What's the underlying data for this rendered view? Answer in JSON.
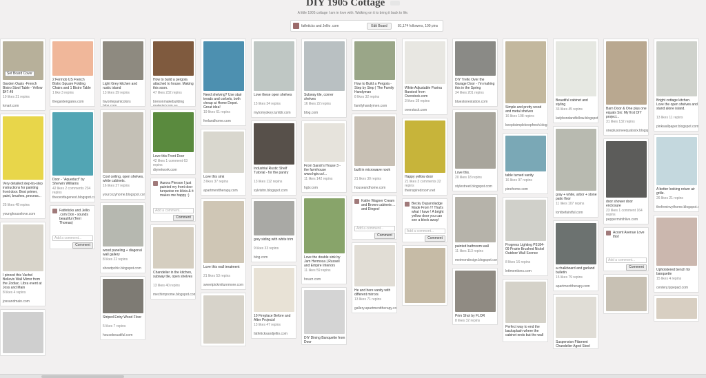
{
  "board": {
    "title": "DIY 1905 Cottage",
    "edit_badge": "Edit",
    "description": "A little 1905 cottage I am in love with. Walking on it to bring it back to life.",
    "owners": "fatfeticks and Jellio .com",
    "edit_button": "Edit Board",
    "stats": "81,174 followers, 100 pins"
  },
  "comment": {
    "placeholder": "Add a comment...",
    "button": "Comment"
  },
  "colors": {
    "bg": "#f2f0f0",
    "pin_bg": "#ffffff",
    "border": "#dddddd"
  },
  "columns": [
    {
      "pins": [
        {
          "desc": "Garden Oasis -French Bistro Stool Table - Yellow $47.49",
          "stats": "10 likes 21 repins",
          "src": "kmart.com",
          "color": "#b7b09a",
          "h": 56,
          "overlay": "Set Board Cover"
        },
        {
          "desc": "Very detailed step-by-step instructions for painting front door. Best primer, paint, brushes, process...",
          "stats": "25 likes 48 repins",
          "src": "younghouselove.com",
          "color": "#e8d64a",
          "h": 92
        },
        {
          "desc": "I pinned this Vachel Bellevis Wall Mirror from the Zodiac. Libra event at Joss and Main",
          "stats": "8 likes 4 repins",
          "src": "jossandmain.com",
          "color": "#d8d4ca",
          "h": 68
        },
        {
          "desc": "",
          "stats": "",
          "src": "",
          "color": "#cfcfcf",
          "h": 60
        }
      ]
    },
    {
      "pins": [
        {
          "desc": "2 Fermob US French Bistro Square Folding Chairs and 1 Bistro Table",
          "stats": "1 like 3 repins",
          "src": "thegardengates.com",
          "color": "#f0b79a",
          "h": 50
        },
        {
          "desc": "Door - \"Aqueduct\" by Sherwin Williams",
          "stats": "42 likes 2 comments 234 repins",
          "src": "theceottagenest.blogspot.com",
          "color": "#52a5b4",
          "h": 92
        },
        {
          "desc": "Fatfeticks and Jellio .com Don - sounds beautiful (Terri Thomas)",
          "stats": "",
          "src": "",
          "color": "#ffffff",
          "h": 0,
          "comment_area": true
        }
      ]
    },
    {
      "pins": [
        {
          "desc": "Light Grey kitchen and rustic island",
          "stats": "13 likes 39 repins",
          "src": "favoritepaintcolors blog.com",
          "color": "#8e8a80",
          "h": 56
        },
        {
          "desc": "Cool ceiling, open shelves, white cabinets.",
          "stats": "16 likes 27 repins",
          "src": "yourcozyhome.blogspot.com",
          "color": "#c4c0b6",
          "h": 88
        },
        {
          "desc": "wood paneling + diagonal wall gallery",
          "stats": "8 likes 22 repins",
          "src": "showtpchic.blogspot.com",
          "color": "#b6b8b0",
          "h": 60
        },
        {
          "desc": "Striped Entry Wood Floor",
          "stats": "5 likes 7 repins",
          "src": "housebeautiful.com",
          "color": "#7e7b74",
          "h": 50
        }
      ]
    },
    {
      "pins": [
        {
          "desc": "How to build a pergola attached to house. Making this soon.",
          "stats": "47 likes 232 repins",
          "src": "brenonmakebuilding material.com.au",
          "color": "#7f5a3e",
          "h": 50
        },
        {
          "desc": "Love this Front Door",
          "stats": "42 likes 1 comment 63 repins",
          "src": "diynetwork.com",
          "color": "#5a8a3e",
          "h": 58
        },
        {
          "desc": "Aurora Pierson I just painted my front door turquoise no kilvia & it makes me happy :)",
          "stats": "",
          "src": "",
          "color": "#ffffff",
          "h": 0,
          "comment_area": true
        },
        {
          "desc": "Chandelier in the kitchen, subway tile, open shelves",
          "stats": "13 likes 40 repins",
          "src": "mechimprome.blogspot.com",
          "color": "#d5cec0",
          "h": 60
        }
      ]
    },
    {
      "pins": [
        {
          "desc": "Need shelving? Use stair treads and corbels, both cheap at Home Depot. Great idea!",
          "stats": "19 likes 61 repins",
          "src": "feelandhome.com",
          "color": "#4d90b0",
          "h": 72
        },
        {
          "desc": "Love this sink",
          "stats": "3 likes 37 repins",
          "src": "apartmenttherapy.com",
          "color": "#d9d7ce",
          "h": 60
        },
        {
          "desc": "Love this wall treatment",
          "stats": "21 likes 53 repins",
          "src": "sweetpickmiturnmore.com",
          "color": "#cfc6b5",
          "h": 90
        },
        {
          "desc": "",
          "stats": "",
          "src": "",
          "color": "#d7d3ca",
          "h": 70
        }
      ]
    },
    {
      "pins": [
        {
          "desc": "Love these open shelves",
          "stats": "15 likes 34 repins",
          "src": "mytomyokey.tumblr.com",
          "color": "#bfc7c4",
          "h": 72
        },
        {
          "desc": "Industrial Rustic Shelf Tutorial - for the pantry",
          "stats": "13 likes 112 repins",
          "src": "sylvistrn.blogspot.com",
          "color": "#57504a",
          "h": 60
        },
        {
          "desc": "grey siding with white trim",
          "stats": "9 likes 33 repins",
          "src": "blog.com",
          "color": "#a9a9a5",
          "h": 50
        },
        {
          "desc": "10 Fireplace Before and After Projects!",
          "stats": "13 likes 47 repins",
          "src": "fatfeticksandjellio.com",
          "color": "#e8e2d6",
          "h": 64
        }
      ]
    },
    {
      "pins": [
        {
          "desc": "Subway tile, corner shelves",
          "stats": "16 likes 22 repins",
          "src": "blog.com",
          "color": "#b9c0c2",
          "h": 72
        },
        {
          "desc": "From Sarah's House 3 - the farmhouse www.hgtv.co/...",
          "stats": "11 likes 142 repins",
          "src": "hgtv.com",
          "color": "#e6e3dc",
          "h": 56
        },
        {
          "desc": "Love the double sink by Jam Hermosa | Russell and Empire Interiors",
          "stats": "11 likes 59 repins",
          "src": "houzz.com",
          "color": "#88a46a",
          "h": 80
        },
        {
          "desc": "DIY Dining Banquette from Door",
          "stats": "",
          "src": "",
          "color": "#d4d4d4",
          "h": 64
        }
      ]
    },
    {
      "pins": [
        {
          "desc": "How to Build a Pergola - Step by Step | The Family Handyman",
          "stats": "8 likes 32 repins",
          "src": "familyhandymen.com",
          "color": "#9aa688",
          "h": 56
        },
        {
          "desc": "built in microwave nook",
          "stats": "21 likes 30 repins",
          "src": "houseandhome.com",
          "color": "#c8c0b4",
          "h": 72
        },
        {
          "desc": "Kathe Wagner Cream and Brown cabinets ... and Dinges!",
          "stats": "",
          "src": "",
          "color": "#ffffff",
          "h": 0,
          "comment_area": true
        },
        {
          "desc": "He and here vanity with different mirrors",
          "stats": "13 likes 71 repins",
          "src": "gallery.apartmenttherapy.com",
          "color": "#e1ddd5",
          "h": 60
        }
      ]
    },
    {
      "pins": [
        {
          "desc": "White Adjustable Pavina Barstool from Overstock.com",
          "stats": "3 likes 18 repins",
          "src": "overstock.com",
          "color": "#e8e7e2",
          "h": 62
        },
        {
          "desc": "Happy yellow door",
          "stats": "21 likes 3 comments 22 repins",
          "src": "theinspiredroom.net",
          "color": "#c7b43a",
          "h": 76
        },
        {
          "desc": "Becky Dupanoladge Made From !!! That's what I have ! A bright yellow door you can see a block away!",
          "stats": "",
          "src": "",
          "color": "#ffffff",
          "h": 0,
          "comment_area": true
        },
        {
          "desc": "",
          "stats": "",
          "src": "",
          "color": "#c6bba6",
          "h": 80
        }
      ]
    },
    {
      "pins": [
        {
          "desc": "DIY Trello Over the Garage Door - I'm making this in the Spring",
          "stats": "34 likes 201 repins",
          "src": "bluestonestation.com",
          "color": "#8a8a86",
          "h": 50
        },
        {
          "desc": "Love this.",
          "stats": "20 likes 18 repins",
          "src": "stylestreet.blogspot.com",
          "color": "#a8a59c",
          "h": 82
        },
        {
          "desc": "painted bathroom wall",
          "stats": "11 likes 113 repins",
          "src": "meimondesign.blogspot.com",
          "color": "#b6b3aa",
          "h": 66
        },
        {
          "desc": "Prim Shot by FLOR",
          "stats": "8 likes 32 repins",
          "src": "",
          "color": "#908b83",
          "h": 60
        }
      ]
    },
    {
      "pins": [
        {
          "desc": "Simple and pretty wood and metal shelves",
          "stats": "16 likes 108 repins",
          "src": "keepitsimplekeepfresh.blogspot.com",
          "color": "#c3b89e",
          "h": 90
        },
        {
          "desc": "table turned vanity",
          "stats": "16 likes 97 repins",
          "src": "pinehome.com",
          "color": "#7aa8b6",
          "h": 52
        },
        {
          "desc": "Progress Lighting P5184-09 Prairie Brushed Nickel Outdoor Wall Sconce",
          "stats": "8 likes 16 repins",
          "src": "lnttmentions.com",
          "color": "#d0d0ca",
          "h": 60
        },
        {
          "desc": "Perfect way to end the backsplash where the cabinet ends but the wall",
          "stats": "",
          "src": "",
          "color": "#d5d2c9",
          "h": 60
        }
      ]
    },
    {
      "pins": [
        {
          "desc": "Beautiful cabinet and styling",
          "stats": "33 likes 45 repins",
          "src": "ladybondandfellow.blogspot.com",
          "color": "#e6e8e2",
          "h": 80
        },
        {
          "desc": "gray + white, arbor + stone patio floor",
          "stats": "11 likes 107 repins",
          "src": "tontbefaintful.com",
          "color": "#b8bab0",
          "h": 90
        },
        {
          "desc": "a chalkboard and garland bulletin",
          "stats": "15 likes 79 repins",
          "src": "apartmenttherapy.com",
          "color": "#6c7270",
          "h": 60
        },
        {
          "desc": "Suspension Filament Chandelier Aged Steel",
          "stats": "",
          "src": "",
          "color": "#e0ddd6",
          "h": 60
        }
      ]
    },
    {
      "pins": [
        {
          "desc": "Barn Door & One plus one equals Six: My first DIY project...",
          "stats": "31 likes 132 repins",
          "src": "oneplusoneequalssix.blogspot.com",
          "color": "#b9a890",
          "h": 92
        },
        {
          "desc": "door shower door enclosure",
          "stats": "23 likes 1 comment 164 repins",
          "src": "pepperminthlive.com",
          "color": "#5c5c5a",
          "h": 82
        },
        {
          "desc": "Accent Avenue Love this!",
          "stats": "",
          "src": "",
          "color": "#ffffff",
          "h": 0,
          "comment_area": true
        },
        {
          "desc": "",
          "stats": "",
          "src": "",
          "color": "#c8c1b4",
          "h": 50
        }
      ]
    },
    {
      "pins": [
        {
          "desc": "Bright cottage kitchen. Love the open shelves and stand alone island.",
          "stats": "13 likes 11 repins",
          "src": "pinkwallpaper.blogspot.com",
          "color": "#cfd2cc",
          "h": 80
        },
        {
          "desc": "A better looking return air grille.",
          "stats": "26 likes 21 repins",
          "src": "thefeminvythome.blogspot.com",
          "color": "#c4d8de",
          "h": 70
        },
        {
          "desc": "Upholstered bench for banquette",
          "stats": "15 likes 4 repins",
          "src": "centery.typepad.com",
          "color": "#cbb7ae",
          "h": 70
        },
        {
          "desc": "",
          "stats": "",
          "src": "",
          "color": "#d8cfc2",
          "h": 30
        }
      ]
    }
  ]
}
